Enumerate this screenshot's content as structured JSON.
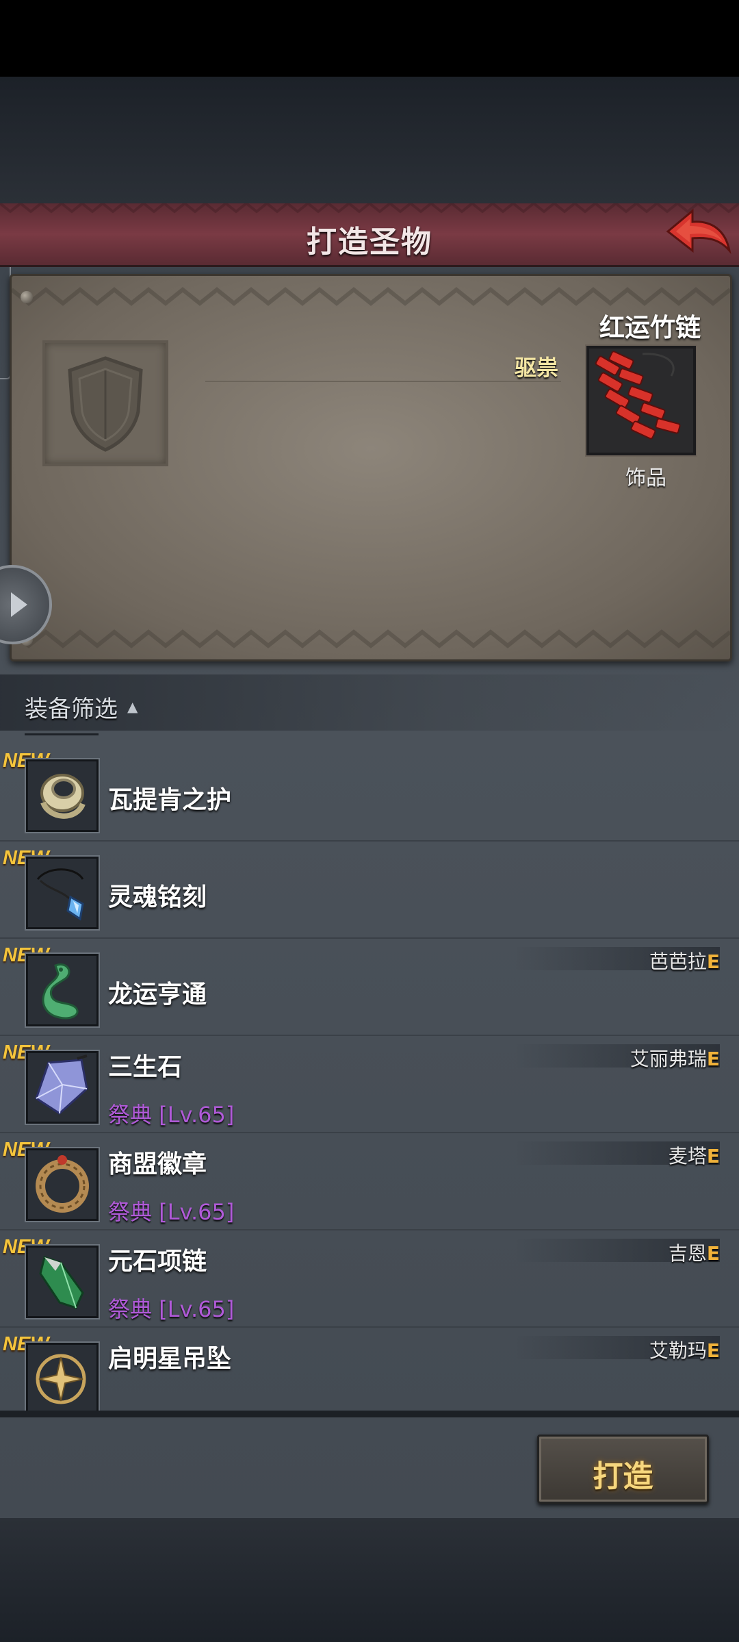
{
  "header": {
    "title": "打造圣物"
  },
  "selected_item": {
    "name": "红运竹链",
    "tag": "驱祟",
    "type": "饰品",
    "icon": "firecracker-chain-icon"
  },
  "filter": {
    "label": "装备筛选",
    "arrow": "▲"
  },
  "list": [
    {
      "badge": "NEW",
      "name": "瓦提肯之护",
      "requirement": "",
      "hero": "",
      "grade": "",
      "icon": "ring-icon"
    },
    {
      "badge": "NEW",
      "name": "灵魂铭刻",
      "requirement": "",
      "hero": "",
      "grade": "",
      "icon": "crystal-pendant-icon"
    },
    {
      "badge": "NEW",
      "name": "龙运亨通",
      "requirement": "",
      "hero": "芭芭拉",
      "grade": "E",
      "icon": "jade-dragon-icon"
    },
    {
      "badge": "NEW",
      "name": "三生石",
      "requirement": "祭典 [Lv.65]",
      "hero": "艾丽弗瑞",
      "grade": "E",
      "icon": "crystal-shard-icon"
    },
    {
      "badge": "NEW",
      "name": "商盟徽章",
      "requirement": "祭典 [Lv.65]",
      "hero": "麦塔",
      "grade": "E",
      "icon": "wreath-badge-icon"
    },
    {
      "badge": "NEW",
      "name": "元石项链",
      "requirement": "祭典 [Lv.65]",
      "hero": "吉恩",
      "grade": "E",
      "icon": "green-crystal-icon"
    },
    {
      "badge": "NEW",
      "name": "启明星吊坠",
      "requirement": "",
      "hero": "艾勒玛",
      "grade": "E",
      "icon": "compass-star-icon"
    }
  ],
  "forge_button": {
    "label": "打造"
  },
  "colors": {
    "header": "#7a3a44",
    "new_badge": "#f4c43c",
    "requirement": "#b05ad8",
    "grade": "#f0b23a",
    "forge": "#f7d77e"
  }
}
